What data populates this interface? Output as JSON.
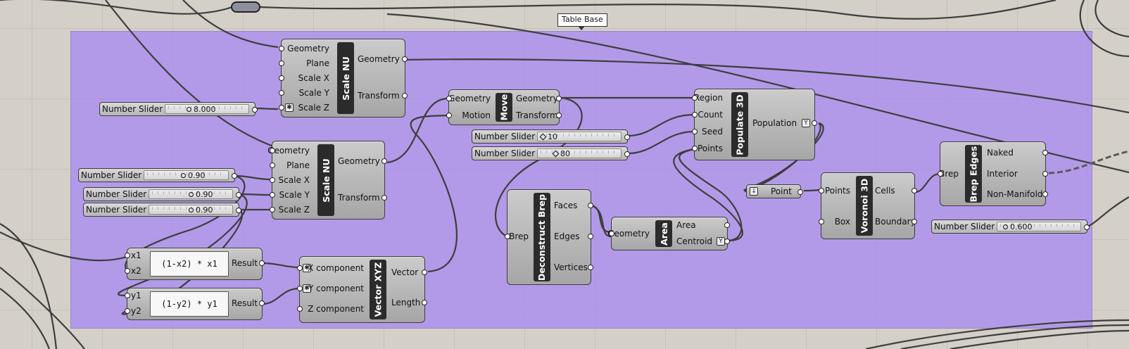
{
  "group": {
    "label": "Table Base",
    "color": "#aa8cf0"
  },
  "components": {
    "scale_nu_1": {
      "title": "Scale NU",
      "inputs": [
        "Geometry",
        "Plane",
        "Scale X",
        "Scale Y",
        "Scale Z"
      ],
      "outputs": [
        "Geometry",
        "Transform"
      ]
    },
    "scale_nu_2": {
      "title": "Scale NU",
      "inputs": [
        "Geometry",
        "Plane",
        "Scale X",
        "Scale Y",
        "Scale Z"
      ],
      "outputs": [
        "Geometry",
        "Transform"
      ]
    },
    "move": {
      "title": "Move",
      "inputs": [
        "Geometry",
        "Motion"
      ],
      "outputs": [
        "Geometry",
        "Transform"
      ]
    },
    "populate_3d": {
      "title": "Populate 3D",
      "inputs": [
        "Region",
        "Count",
        "Seed",
        "Points"
      ],
      "outputs": [
        "Population"
      ]
    },
    "deconstruct_brep": {
      "title": "Deconstruct Brep",
      "inputs": [
        "Brep"
      ],
      "outputs": [
        "Faces",
        "Edges",
        "Vertices"
      ]
    },
    "area": {
      "title": "Area",
      "inputs": [
        "Geometry"
      ],
      "outputs": [
        "Area",
        "Centroid"
      ]
    },
    "point": {
      "title": "Point"
    },
    "voronoi_3d": {
      "title": "Voronoi 3D",
      "inputs": [
        "Points",
        "Box"
      ],
      "outputs": [
        "Cells",
        "Boundary"
      ]
    },
    "brep_edges": {
      "title": "Brep Edges",
      "inputs": [
        "Brep"
      ],
      "outputs": [
        "Naked",
        "Interior",
        "Non-Manifold"
      ]
    },
    "vector_xyz": {
      "title": "Vector XYZ",
      "inputs": [
        "X component",
        "Y component",
        "Z component"
      ],
      "outputs": [
        "Vector",
        "Length"
      ]
    },
    "expr_x": {
      "inputs": [
        "x1",
        "x2"
      ],
      "expression": "(1-x2) * x1",
      "output": "Result"
    },
    "expr_y": {
      "inputs": [
        "y1",
        "y2"
      ],
      "expression": "(1-y2) * y1",
      "output": "Result"
    }
  },
  "sliders": [
    {
      "label": "Number Slider",
      "value": "8.000"
    },
    {
      "label": "Number Slider",
      "value": "0.90"
    },
    {
      "label": "Number Slider",
      "value": "0.90"
    },
    {
      "label": "Number Slider",
      "value": "0.90"
    },
    {
      "label": "Number Slider",
      "value": "10"
    },
    {
      "label": "Number Slider",
      "value": "80"
    },
    {
      "label": "Number Slider",
      "value": "0.600"
    }
  ]
}
